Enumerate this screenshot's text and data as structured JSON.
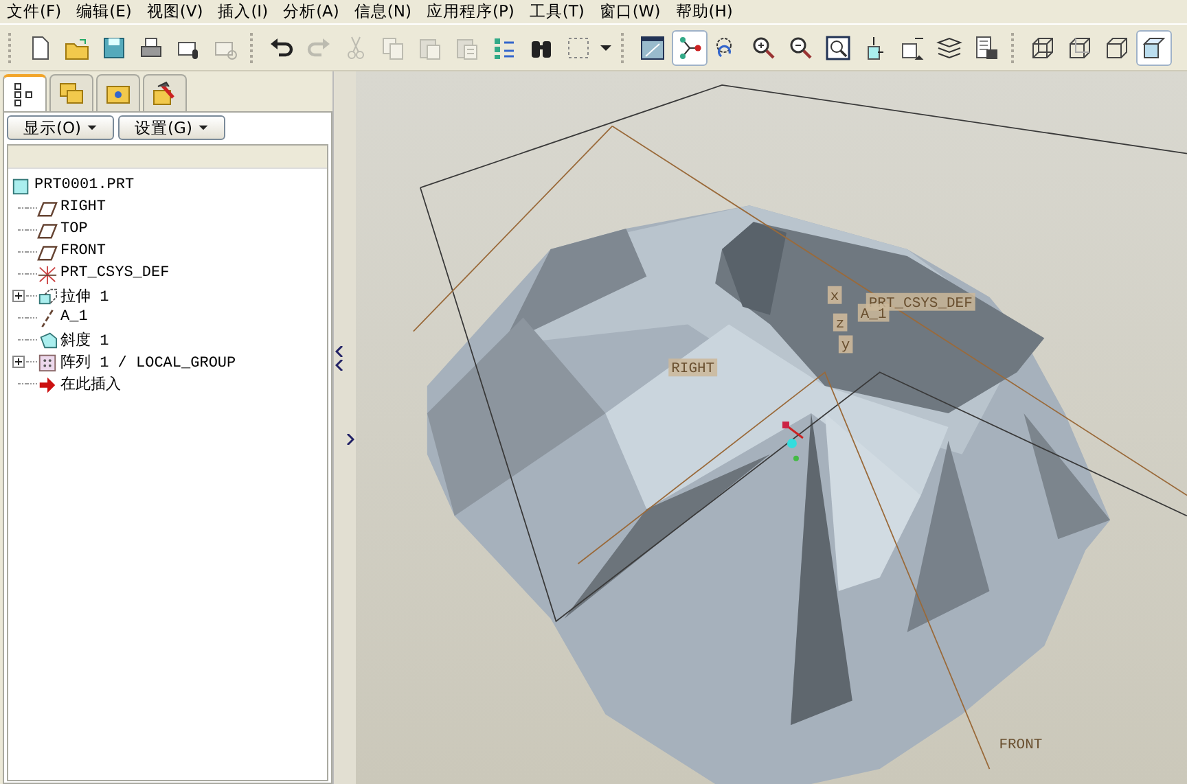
{
  "menu": [
    {
      "label": "文件(F)"
    },
    {
      "label": "编辑(E)"
    },
    {
      "label": "视图(V)"
    },
    {
      "label": "插入(I)"
    },
    {
      "label": "分析(A)"
    },
    {
      "label": "信息(N)"
    },
    {
      "label": "应用程序(P)"
    },
    {
      "label": "工具(T)"
    },
    {
      "label": "窗口(W)"
    },
    {
      "label": "帮助(H)"
    }
  ],
  "toolbar": [
    [
      {
        "kind": "new",
        "disabled": false,
        "selected": false
      },
      {
        "kind": "open",
        "disabled": false,
        "selected": false
      },
      {
        "kind": "save",
        "disabled": false,
        "selected": false
      },
      {
        "kind": "print",
        "disabled": false,
        "selected": false
      },
      {
        "kind": "mail",
        "disabled": false,
        "selected": false
      },
      {
        "kind": "maillink",
        "disabled": true,
        "selected": false
      }
    ],
    [
      {
        "kind": "undo",
        "disabled": false,
        "selected": false
      },
      {
        "kind": "redo",
        "disabled": true,
        "selected": false
      },
      {
        "kind": "cut",
        "disabled": true,
        "selected": false
      },
      {
        "kind": "copy",
        "disabled": true,
        "selected": false
      },
      {
        "kind": "paste",
        "disabled": true,
        "selected": false
      },
      {
        "kind": "pastespecial",
        "disabled": true,
        "selected": false
      },
      {
        "kind": "regen",
        "disabled": false,
        "selected": false
      },
      {
        "kind": "find",
        "disabled": false,
        "selected": false
      },
      {
        "kind": "selbox",
        "disabled": false,
        "selected": false
      },
      {
        "kind": "caret",
        "disabled": false,
        "selected": false
      }
    ],
    [
      {
        "kind": "repaint",
        "disabled": false,
        "selected": false
      },
      {
        "kind": "spin",
        "disabled": false,
        "selected": true
      },
      {
        "kind": "orient",
        "disabled": false,
        "selected": false
      },
      {
        "kind": "zoomin",
        "disabled": false,
        "selected": false
      },
      {
        "kind": "zoomout",
        "disabled": false,
        "selected": false
      },
      {
        "kind": "refit",
        "disabled": false,
        "selected": false
      },
      {
        "kind": "reorient",
        "disabled": false,
        "selected": false
      },
      {
        "kind": "namedview",
        "disabled": false,
        "selected": false
      },
      {
        "kind": "layers",
        "disabled": false,
        "selected": false
      },
      {
        "kind": "treeset",
        "disabled": false,
        "selected": false
      }
    ],
    [
      {
        "kind": "wire",
        "disabled": false,
        "selected": false
      },
      {
        "kind": "hidden",
        "disabled": false,
        "selected": false
      },
      {
        "kind": "nohidden",
        "disabled": false,
        "selected": false
      },
      {
        "kind": "shade",
        "disabled": false,
        "selected": true
      }
    ]
  ],
  "panel_tabs": [
    {
      "kind": "tree",
      "selected": true
    },
    {
      "kind": "folders",
      "selected": false
    },
    {
      "kind": "favorites",
      "selected": false
    },
    {
      "kind": "tools",
      "selected": false
    }
  ],
  "panel_buttons": [
    {
      "label": "显示(O)"
    },
    {
      "label": "设置(G)"
    }
  ],
  "model_tree": [
    {
      "label": "PRT0001.PRT",
      "kind": "part",
      "children": [
        {
          "label": "RIGHT",
          "kind": "plane",
          "expandable": false
        },
        {
          "label": "TOP",
          "kind": "plane",
          "expandable": false
        },
        {
          "label": "FRONT",
          "kind": "plane",
          "expandable": false
        },
        {
          "label": "PRT_CSYS_DEF",
          "kind": "csys",
          "expandable": false
        },
        {
          "label": "拉伸 1",
          "kind": "extrude",
          "expandable": true
        },
        {
          "label": "A_1",
          "kind": "axis",
          "expandable": false
        },
        {
          "label": "斜度 1",
          "kind": "draft",
          "expandable": false
        },
        {
          "label": "阵列 1 / LOCAL_GROUP",
          "kind": "pattern",
          "expandable": true
        },
        {
          "label": "在此插入",
          "kind": "insert",
          "expandable": false
        }
      ]
    }
  ],
  "viewport": {
    "labels": [
      {
        "text": "RIGHT",
        "kind": "datum"
      },
      {
        "text": "PRT_CSYS_DEF",
        "kind": "datum"
      },
      {
        "text": "A_1",
        "kind": "datum"
      },
      {
        "text": "x",
        "kind": "axis"
      },
      {
        "text": "z",
        "kind": "axis"
      },
      {
        "text": "y",
        "kind": "axis"
      },
      {
        "text": "FRONT",
        "kind": "plain"
      }
    ]
  }
}
